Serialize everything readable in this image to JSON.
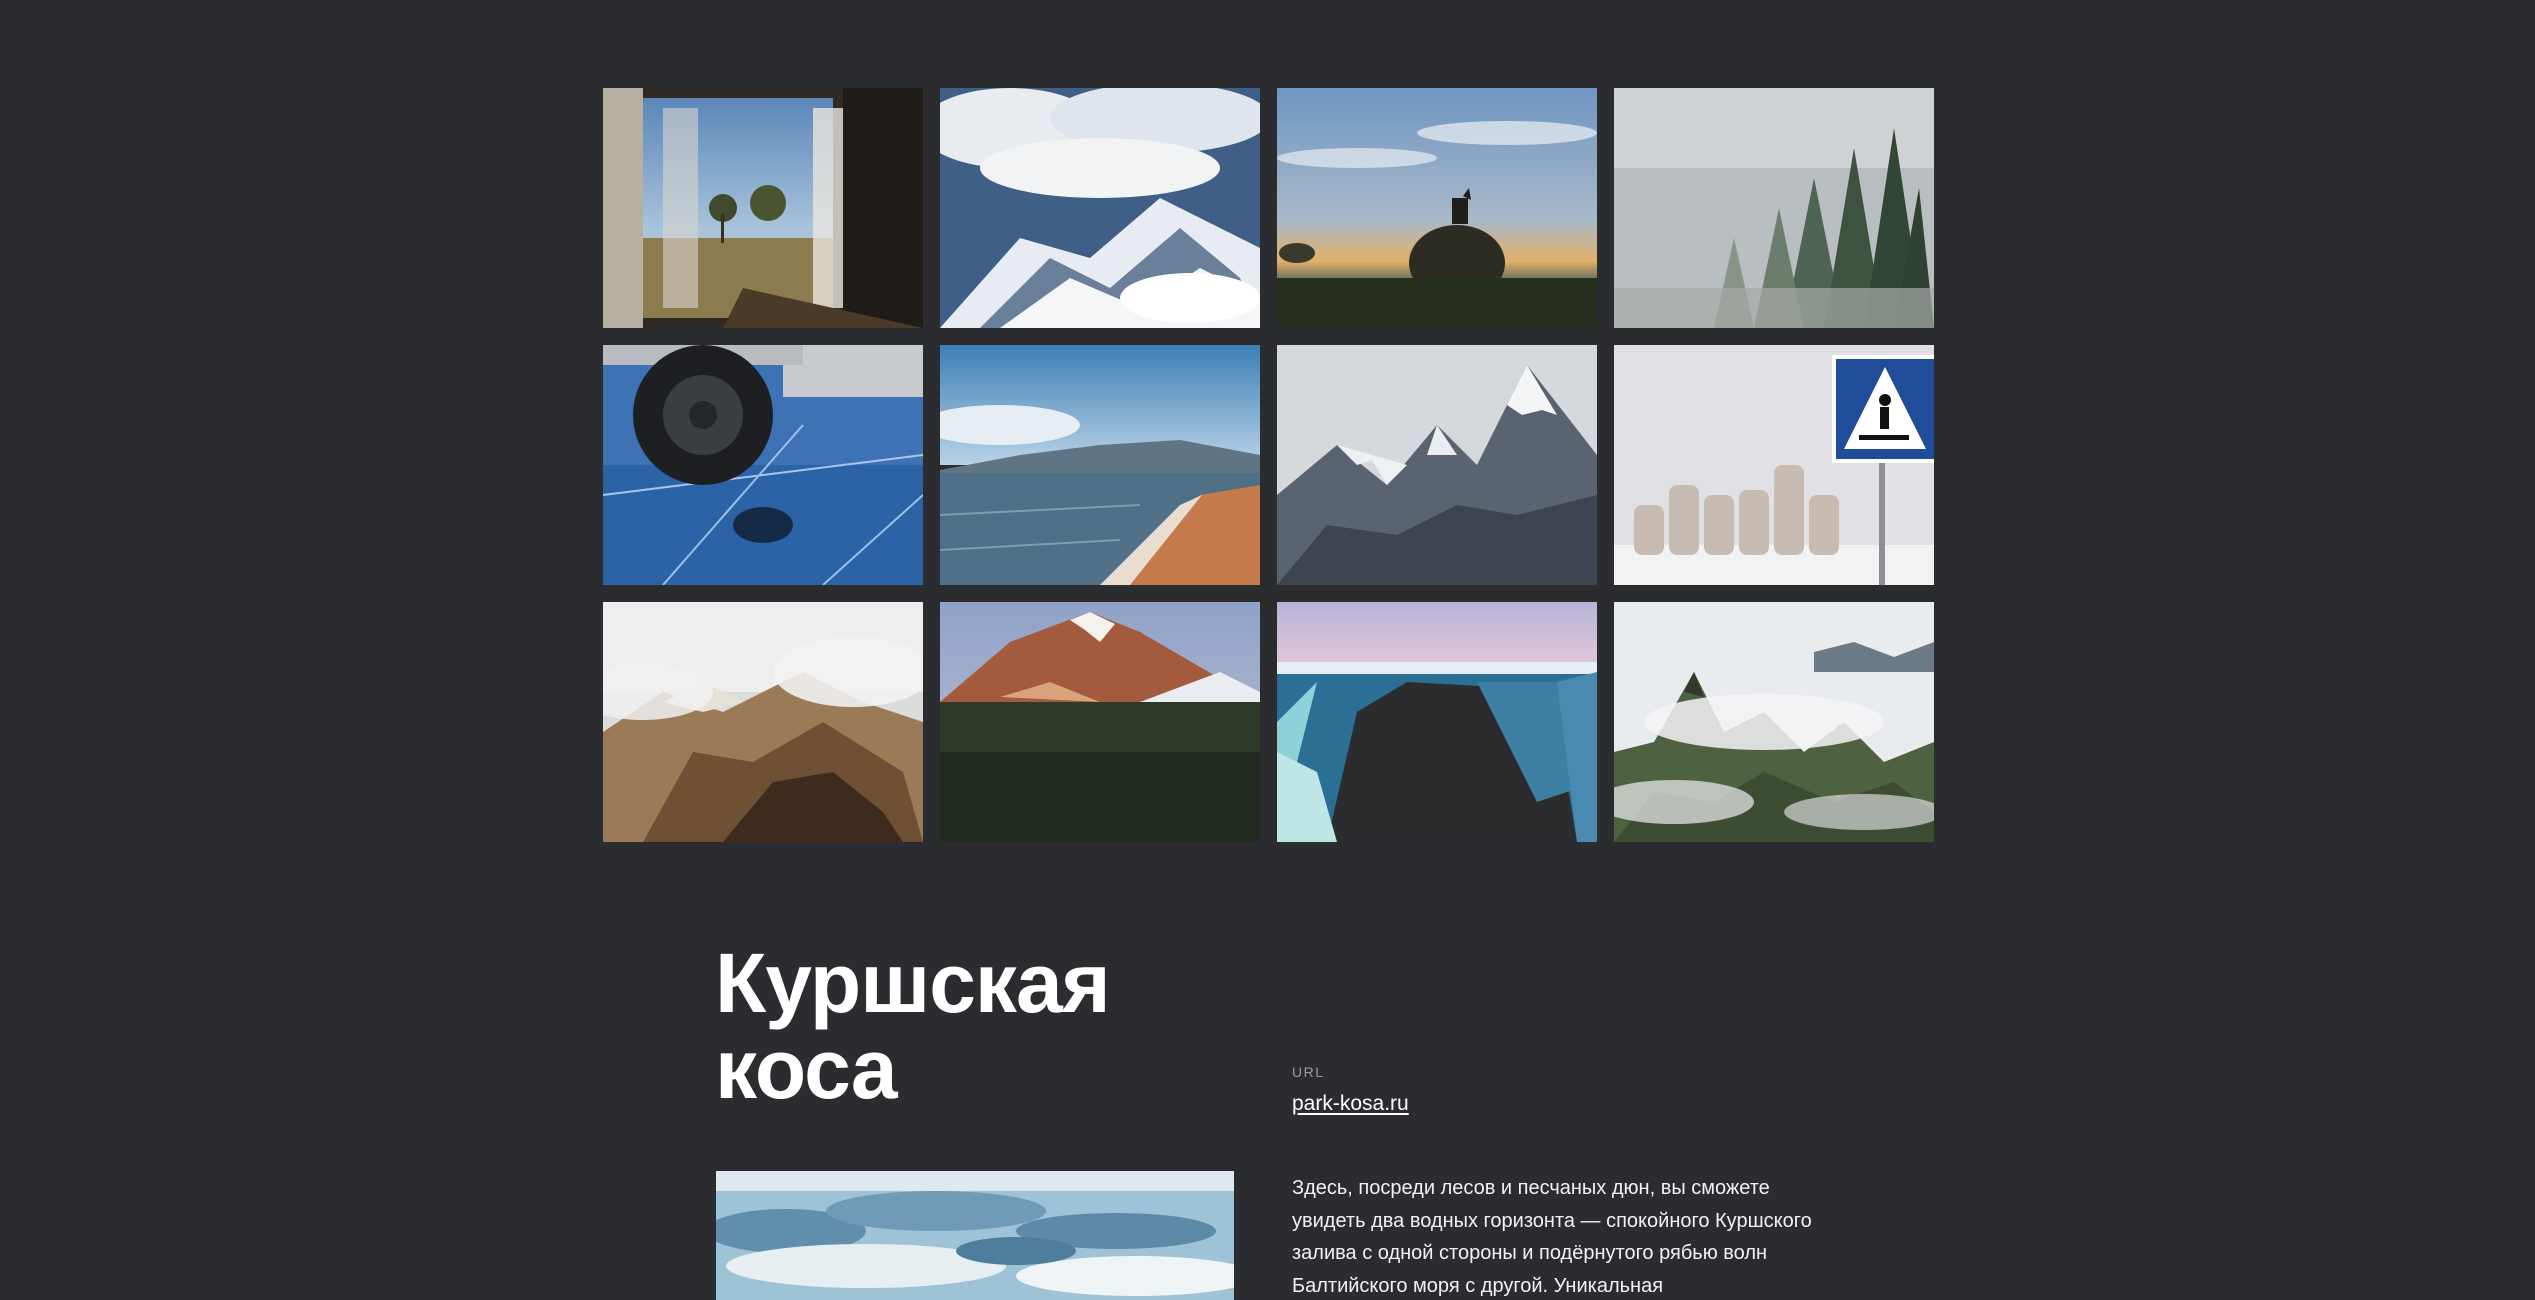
{
  "gallery": {
    "images": [
      {
        "name": "train-window-photo"
      },
      {
        "name": "clouds-mountains-photo"
      },
      {
        "name": "dog-on-haystack-photo"
      },
      {
        "name": "foggy-forest-photo"
      },
      {
        "name": "car-wheel-on-ice-photo"
      },
      {
        "name": "lake-beach-photo"
      },
      {
        "name": "snowy-peaks-photo"
      },
      {
        "name": "crosswalk-sign-tetrapods-photo"
      },
      {
        "name": "volcanic-valley-fog-photo"
      },
      {
        "name": "volcano-sunset-photo"
      },
      {
        "name": "coastal-cliff-photo"
      },
      {
        "name": "misty-peaks-photo"
      }
    ]
  },
  "article": {
    "title_line1": "Куршская",
    "title_line2": "коса",
    "url_label": "URL",
    "url_text": "park-kosa.ru",
    "description": "Здесь, посреди лесов и песчаных дюн, вы сможете увидеть два водных горизонта — спокойного Куршского залива с одной стороны и подёрнутого рябью волн Балтийского моря с другой. Уникальная"
  }
}
